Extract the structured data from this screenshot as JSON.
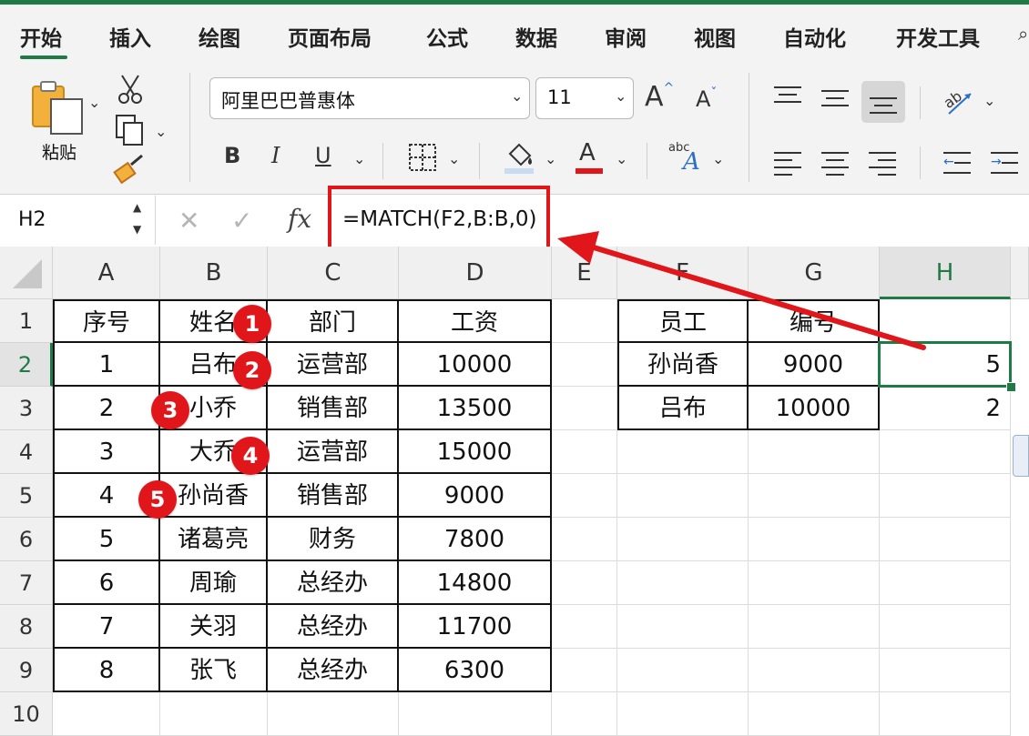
{
  "ribbon": {
    "tabs": [
      "开始",
      "插入",
      "绘图",
      "页面布局",
      "公式",
      "数据",
      "审阅",
      "视图",
      "自动化",
      "开发工具"
    ],
    "active_tab": "开始",
    "paste_label": "粘贴",
    "font_name": "阿里巴巴普惠体",
    "font_size": "11",
    "grow_font": "A",
    "shrink_font": "A",
    "bold": "B",
    "italic": "I",
    "underline": "U",
    "font_color_glyph": "A",
    "wrap_glyph": "abc",
    "accent_color": "#1f7a45",
    "font_color_bar": "#e0161b"
  },
  "formula_bar": {
    "name_box": "H2",
    "cancel": "✕",
    "enter": "✓",
    "fx": "fx",
    "formula": "=MATCH(F2,B:B,0)"
  },
  "sheet": {
    "columns": [
      "A",
      "B",
      "C",
      "D",
      "E",
      "F",
      "G",
      "H"
    ],
    "rows": [
      "1",
      "2",
      "3",
      "4",
      "5",
      "6",
      "7",
      "8",
      "9",
      "10"
    ],
    "selected_cell": "H2",
    "table1": {
      "headers": [
        "序号",
        "姓名",
        "部门",
        "工资"
      ],
      "rows": [
        [
          "1",
          "吕布",
          "运营部",
          "10000"
        ],
        [
          "2",
          "小乔",
          "销售部",
          "13500"
        ],
        [
          "3",
          "大乔",
          "运营部",
          "15000"
        ],
        [
          "4",
          "孙尚香",
          "销售部",
          "9000"
        ],
        [
          "5",
          "诸葛亮",
          "财务",
          "7800"
        ],
        [
          "6",
          "周瑜",
          "总经办",
          "14800"
        ],
        [
          "7",
          "关羽",
          "总经办",
          "11700"
        ],
        [
          "8",
          "张飞",
          "总经办",
          "6300"
        ]
      ]
    },
    "table2": {
      "headers": [
        "员工",
        "编号",
        ""
      ],
      "rows": [
        [
          "孙尚香",
          "9000",
          "5"
        ],
        [
          "吕布",
          "10000",
          "2"
        ]
      ]
    }
  },
  "annotations": {
    "badges": [
      "1",
      "2",
      "3",
      "4",
      "5"
    ],
    "highlight_color": "#e0161b"
  }
}
